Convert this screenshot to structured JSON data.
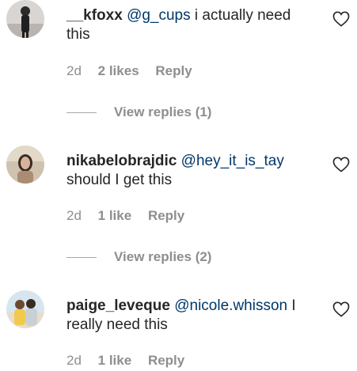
{
  "comments": [
    {
      "username": "__kfoxx",
      "mention": "@g_cups",
      "text_inline": " i actually need",
      "text_rest": "this",
      "time": "2d",
      "likes": "2 likes",
      "reply_label": "Reply",
      "view_replies": "View replies (1)"
    },
    {
      "username": "nikabelobrajdic",
      "mention": "@hey_it_is_tay",
      "text_inline": "",
      "text_rest": "should I get this",
      "time": "2d",
      "likes": "1 like",
      "reply_label": "Reply",
      "view_replies": "View replies (2)"
    },
    {
      "username": "paige_leveque",
      "mention": "@nicole.whisson",
      "text_inline": " I",
      "text_rest": "really need this",
      "time": "2d",
      "likes": "1 like",
      "reply_label": "Reply"
    }
  ],
  "icons": {
    "like": "heart-outline-icon"
  },
  "colors": {
    "text": "#262626",
    "mention": "#00376b",
    "secondary": "#8e8e8e"
  }
}
